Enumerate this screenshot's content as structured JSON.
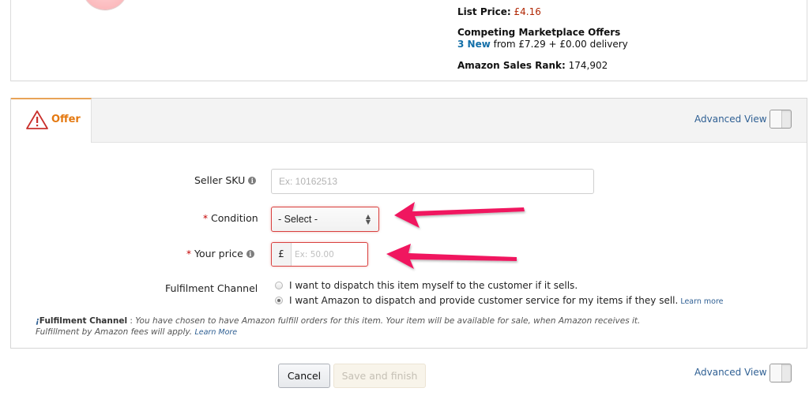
{
  "product": {
    "list_price_label": "List Price:",
    "list_price_value": "£4.16",
    "competing_offers_title": "Competing Marketplace Offers",
    "competing_offers_link": "3 New",
    "competing_offers_text": "from £7.29  + £0.00 delivery",
    "sales_rank_label": "Amazon Sales Rank:",
    "sales_rank_value": "174,902"
  },
  "offer_panel": {
    "tab_label": "Offer",
    "tab_icon": "warning-triangle-icon",
    "advanced_view_label": "Advanced View",
    "advanced_view_on": false,
    "fields": {
      "seller_sku": {
        "label": "Seller SKU",
        "placeholder": "Ex: 10162513",
        "value": ""
      },
      "condition": {
        "label": "Condition",
        "required": "*",
        "selected": "- Select -"
      },
      "your_price": {
        "label": "Your price",
        "required": "*",
        "currency": "£",
        "placeholder": "Ex: 50.00",
        "value": ""
      },
      "fulfilment_channel": {
        "label": "Fulfilment Channel",
        "options": [
          {
            "label": "I want to dispatch this item myself to the customer if it sells.",
            "checked": false
          },
          {
            "label": "I want Amazon to dispatch and provide customer service for my items if they sell.",
            "checked": true,
            "link": "Learn more"
          }
        ]
      }
    },
    "note": {
      "icon": "¡",
      "title": "Fulfilment Channel",
      "separator": " : ",
      "body": "You have chosen to have Amazon fulfill orders for this item. Your item will be available for sale, when Amazon receives it. Fulfillment by Amazon fees will apply.",
      "link": "Learn More"
    }
  },
  "footer": {
    "cancel_label": "Cancel",
    "save_label": "Save and finish",
    "save_enabled": false,
    "advanced_view_label": "Advanced View",
    "advanced_view_on": false
  },
  "annotations": {
    "arrow_color": "#f0195f",
    "arrows": [
      "arrow-to-condition",
      "arrow-to-price"
    ]
  }
}
